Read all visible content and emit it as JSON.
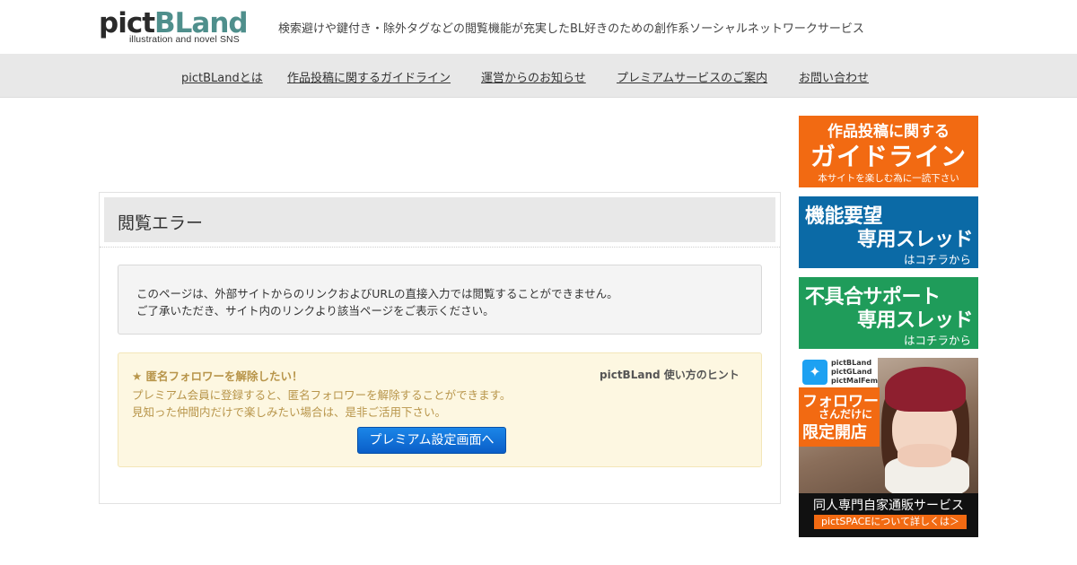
{
  "header": {
    "logo_main_a": "pict",
    "logo_main_b": "BLand",
    "logo_sub": "illustration and novel SNS",
    "tagline": "検索避けや鍵付き・除外タグなどの閲覧機能が充実したBL好きのための創作系ソーシャルネットワークサービス"
  },
  "nav": {
    "items": [
      {
        "label": "pictBLandとは"
      },
      {
        "label": "作品投稿に関するガイドライン"
      },
      {
        "label": "運営からのお知らせ"
      },
      {
        "label": "プレミアムサービスのご案内"
      },
      {
        "label": "お問い合わせ"
      }
    ]
  },
  "panel": {
    "title": "閲覧エラー",
    "notice_line1": "このページは、外部サイトからのリンクおよびURLの直接入力では閲覧することができません。",
    "notice_line2": "ご了承いただき、サイト内のリンクより該当ページをご表示ください。"
  },
  "hint": {
    "title": "★ 匿名フォロワーを解除したい！",
    "label": "pictBLand 使い方のヒント",
    "body_line1": "プレミアム会員に登録すると、匿名フォロワーを解除することができます。",
    "body_line2": "見知った仲間内だけで楽しみたい場合は、是非ご活用下さい。",
    "button_label": "プレミアム設定画面へ"
  },
  "sidebar": {
    "guide": {
      "line1": "作品投稿に関する",
      "line2": "ガイドライン",
      "line3": "本サイトを楽しむ為に一読下さい",
      "color": "#f26a12"
    },
    "request": {
      "line1": "機能要望",
      "line2": "専用スレッド",
      "line3": "はコチラから",
      "color": "#0b6aa6"
    },
    "support": {
      "line1": "不具合サポート",
      "line2": "専用スレッド",
      "line3": "はコチラから",
      "color": "#1f9c5a"
    },
    "space": {
      "sns_icon": "twitter-bird-icon",
      "sns1": "pictBLand",
      "sns2": "pictGLand",
      "sns3": "pictMalFem",
      "follow1": "フォロワー",
      "follow2": "さんだけに",
      "follow3": "限定開店",
      "foot1": "同人専門自家通販サービス",
      "foot2": "pictSPACEについて詳しくは＞"
    }
  }
}
